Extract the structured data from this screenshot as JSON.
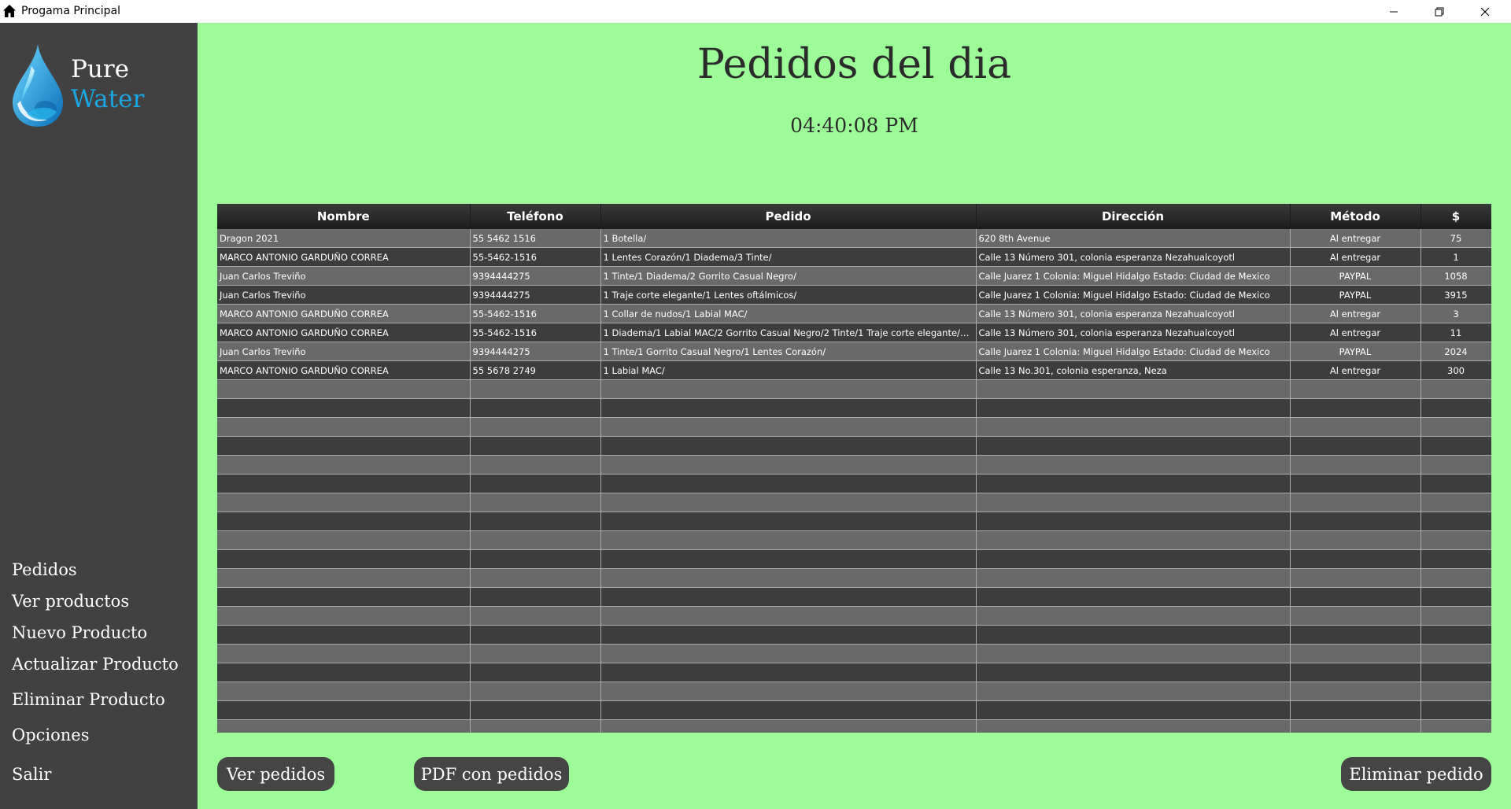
{
  "window": {
    "title": "Progama Principal",
    "icon": "home-icon"
  },
  "logo": {
    "line1": "Pure",
    "line2": "Water",
    "icon": "water-drop-icon",
    "accent_color": "#1aa6e0"
  },
  "sidebar": {
    "items": [
      {
        "label": "Pedidos"
      },
      {
        "label": "Ver productos"
      },
      {
        "label": "Nuevo Producto"
      },
      {
        "label": "Actualizar Producto"
      },
      {
        "label": "Eliminar Producto"
      },
      {
        "label": "Opciones"
      },
      {
        "label": "Salir"
      }
    ]
  },
  "main": {
    "title": "Pedidos del dia",
    "time": "04:40:08 PM"
  },
  "table": {
    "columns": [
      "Nombre",
      "Teléfono",
      "Pedido",
      "Dirección",
      "Método",
      "$"
    ],
    "rows": [
      [
        "Dragon 2021",
        "55 5462 1516",
        "1 Botella/",
        "620 8th Avenue",
        "Al entregar",
        "75"
      ],
      [
        "MARCO ANTONIO GARDUÑO CORREA",
        "55-5462-1516",
        "1 Lentes Corazón/1 Diadema/3 Tinte/",
        "Calle 13 Número 301, colonia esperanza Nezahualcoyotl",
        "Al entregar",
        "1"
      ],
      [
        "Juan Carlos Treviño",
        "9394444275",
        "1 Tinte/1 Diadema/2 Gorrito Casual Negro/",
        "Calle Juarez 1 Colonia: Miguel Hidalgo Estado: Ciudad de Mexico",
        "PAYPAL",
        "1058"
      ],
      [
        "Juan Carlos Treviño",
        "9394444275",
        "1 Traje corte elegante/1 Lentes oftálmicos/",
        "Calle Juarez 1 Colonia: Miguel Hidalgo Estado: Ciudad de Mexico",
        "PAYPAL",
        "3915"
      ],
      [
        "MARCO ANTONIO GARDUÑO CORREA",
        "55-5462-1516",
        "1 Collar de nudos/1 Labial MAC/",
        "Calle 13 Número 301, colonia esperanza Nezahualcoyotl",
        "Al entregar",
        "3"
      ],
      [
        "MARCO ANTONIO GARDUÑO CORREA",
        "55-5462-1516",
        "1 Diadema/1 Labial MAC/2 Gorrito Casual Negro/2 Tinte/1 Traje corte elegante/4 Lent...",
        "Calle 13 Número 301, colonia esperanza Nezahualcoyotl",
        "Al entregar",
        "11"
      ],
      [
        "Juan Carlos Treviño",
        "9394444275",
        "1 Tinte/1 Gorrito Casual Negro/1 Lentes Corazón/",
        "Calle Juarez 1 Colonia: Miguel Hidalgo Estado: Ciudad de Mexico",
        "PAYPAL",
        "2024"
      ],
      [
        "MARCO ANTONIO GARDUÑO CORREA",
        "55 5678 2749",
        "1 Labial MAC/",
        "Calle 13 No.301, colonia esperanza, Neza",
        "Al entregar",
        "300"
      ]
    ]
  },
  "buttons": {
    "ver_pedidos": "Ver pedidos",
    "pdf": "PDF con pedidos",
    "eliminar": "Eliminar pedido"
  },
  "colors": {
    "background": "#9cfc98",
    "sidebar": "#414141",
    "button": "#454545"
  }
}
